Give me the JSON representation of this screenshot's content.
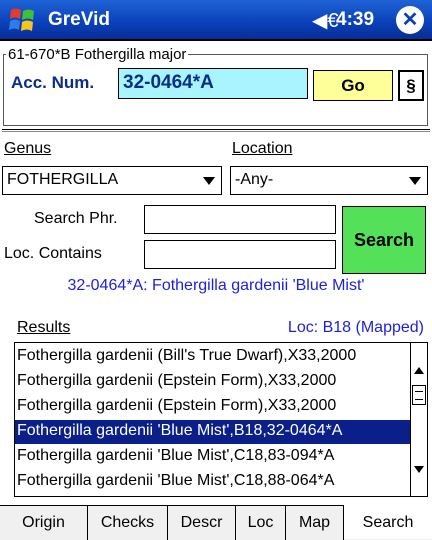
{
  "titlebar": {
    "app_title": "GreVid",
    "time": "4:39",
    "close_label": "✕",
    "speaker_glyph": "◀€"
  },
  "record": {
    "group_title": "61-670*B Fothergilla major",
    "acc_label": "Acc. Num.",
    "acc_value": "32-0464*A",
    "go_label": "Go",
    "section_label": "§"
  },
  "filters": {
    "genus_label": "Genus",
    "genus_value": "FOTHERGILLA",
    "location_label": "Location",
    "location_value": "-Any-",
    "search_phr_label": "Search Phr.",
    "loc_contains_label": "Loc. Contains",
    "search_label": "Search"
  },
  "selected_info": "32-0464*A: Fothergilla gardenii 'Blue Mist'",
  "results": {
    "label": "Results",
    "loc_info": "Loc: B18 (Mapped)",
    "items": [
      "Fothergilla gardenii (Bill's True Dwarf),X33,2000",
      "Fothergilla gardenii (Epstein Form),X33,2000",
      "Fothergilla gardenii (Epstein Form),X33,2000",
      "Fothergilla gardenii 'Blue Mist',B18,32-0464*A",
      "Fothergilla gardenii 'Blue Mist',C18,83-094*A",
      "Fothergilla gardenii 'Blue Mist',C18,88-064*A"
    ],
    "selected_index": 3
  },
  "tabs": [
    {
      "label": "Origin"
    },
    {
      "label": "Checks"
    },
    {
      "label": "Descr"
    },
    {
      "label": "Loc"
    },
    {
      "label": "Map"
    },
    {
      "label": "Search"
    }
  ],
  "active_tab": "Search",
  "colors": {
    "title_bar": "#0a3fb8",
    "acc_field": "#a8f5ff",
    "go_button": "#ffff99",
    "search_button": "#55e05a",
    "info_text": "#1e1ee0",
    "selection": "#0a1f8a"
  }
}
